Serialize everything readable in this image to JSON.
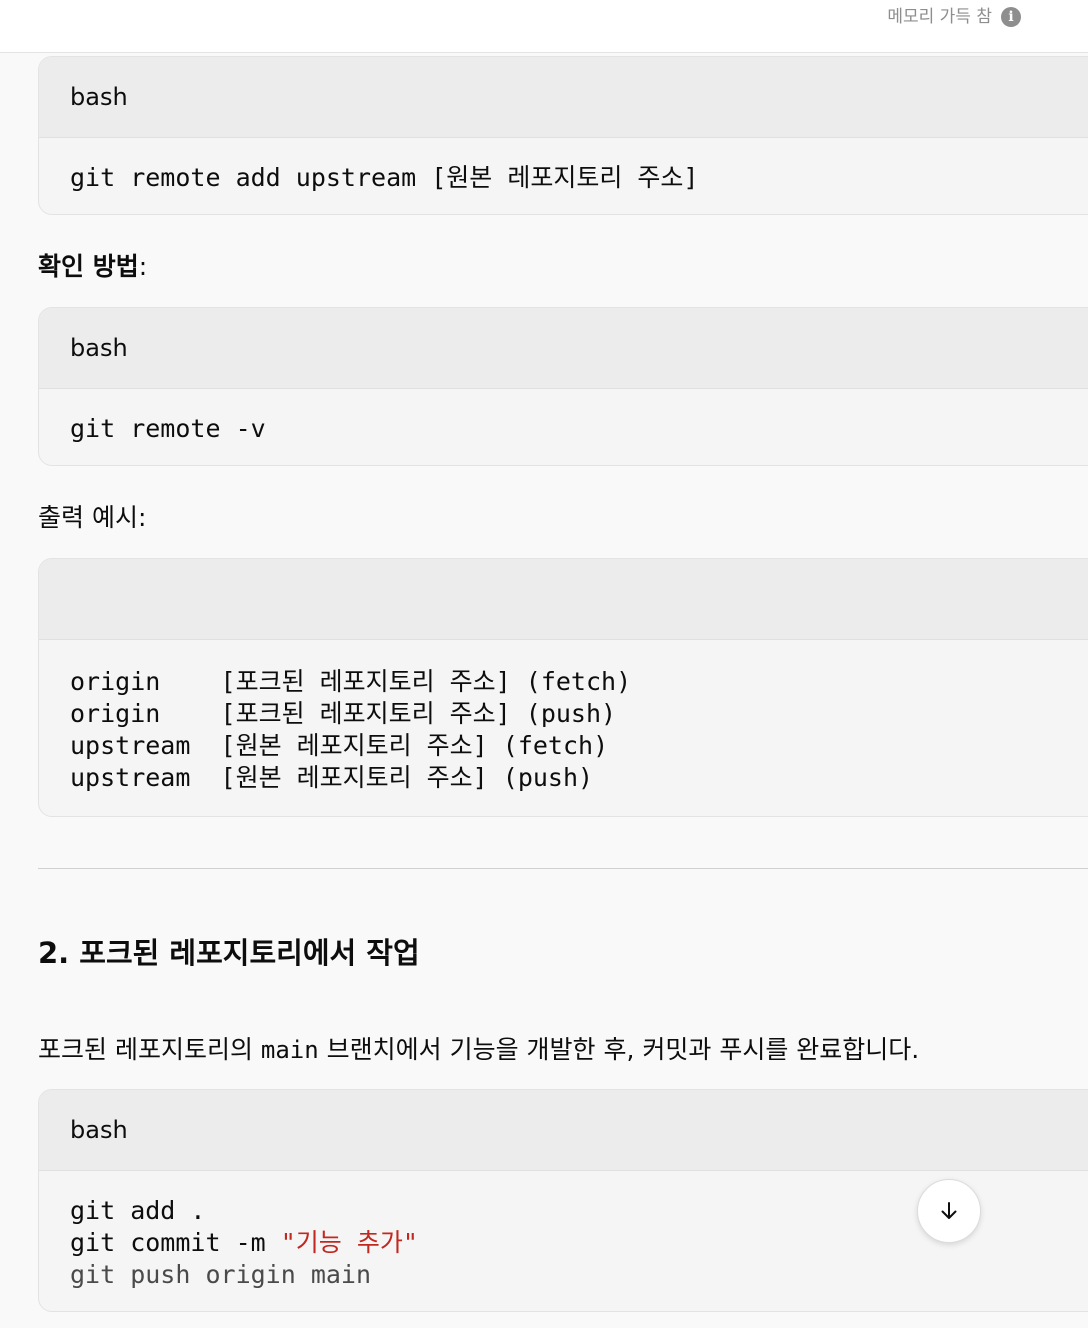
{
  "header": {
    "memory_status": "메모리 가득 참",
    "info_icon": "info-icon"
  },
  "blocks": {
    "remote_add": {
      "lang": "bash",
      "lines": [
        "git remote add upstream [원본 레포지토리 주소]"
      ]
    },
    "verify_heading": "확인 방법",
    "verify_colon": ":",
    "verify": {
      "lang": "bash",
      "lines": [
        "git remote -v"
      ]
    },
    "output_heading": "출력 예시:",
    "output": {
      "lang": "",
      "lines": [
        "origin    [포크된 레포지토리 주소] (fetch)",
        "origin    [포크된 레포지토리 주소] (push)",
        "upstream  [원본 레포지토리 주소] (fetch)",
        "upstream  [원본 레포지토리 주소] (push)"
      ]
    },
    "section_title": "2. 포크된 레포지토리에서 작업",
    "section_desc_before": "포크된 레포지토리의 ",
    "section_desc_code": "main",
    "section_desc_after": " 브랜치에서 기능을 개발한 후, 커밋과 푸시를 완료합니다.",
    "work": {
      "lang": "bash",
      "line1": "git add .",
      "line2_cmd": "git commit -m ",
      "line2_str": "\"기능 추가\"",
      "line3": "git push origin main"
    }
  },
  "scroll_button": {
    "icon": "arrow-down-icon"
  },
  "colors": {
    "string_literal": "#c1281f",
    "code_header_bg": "#ececec",
    "code_body_bg": "#f5f5f5"
  }
}
